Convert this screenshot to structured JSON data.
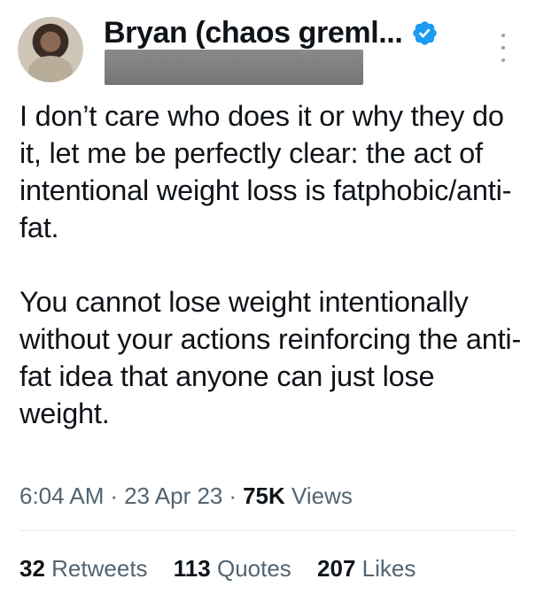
{
  "author": {
    "display_name": "Bryan (chaos greml...",
    "verified_icon": "verified-badge-icon",
    "avatar": "profile-photo",
    "handle_redacted": true
  },
  "tweet": {
    "paragraphs": [
      "I don’t care who does it or why they do it, let me be perfectly clear: the act of intentional weight loss is fatphobic/anti-fat.",
      "You cannot lose weight intentionally without your actions reinforcing the anti-fat idea that anyone can just lose weight."
    ],
    "time": "6:04 AM",
    "date": "23 Apr 23",
    "separator": "·",
    "views_count": "75K",
    "views_label": "Views"
  },
  "stats": {
    "retweets": {
      "count": "32",
      "label": "Retweets"
    },
    "quotes": {
      "count": "113",
      "label": "Quotes"
    },
    "likes": {
      "count": "207",
      "label": "Likes"
    }
  },
  "colors": {
    "text": "#0f1419",
    "secondary_text": "#536471",
    "verified_blue": "#1d9bf0",
    "divider": "#e7e9ea",
    "redaction": "#808080"
  }
}
